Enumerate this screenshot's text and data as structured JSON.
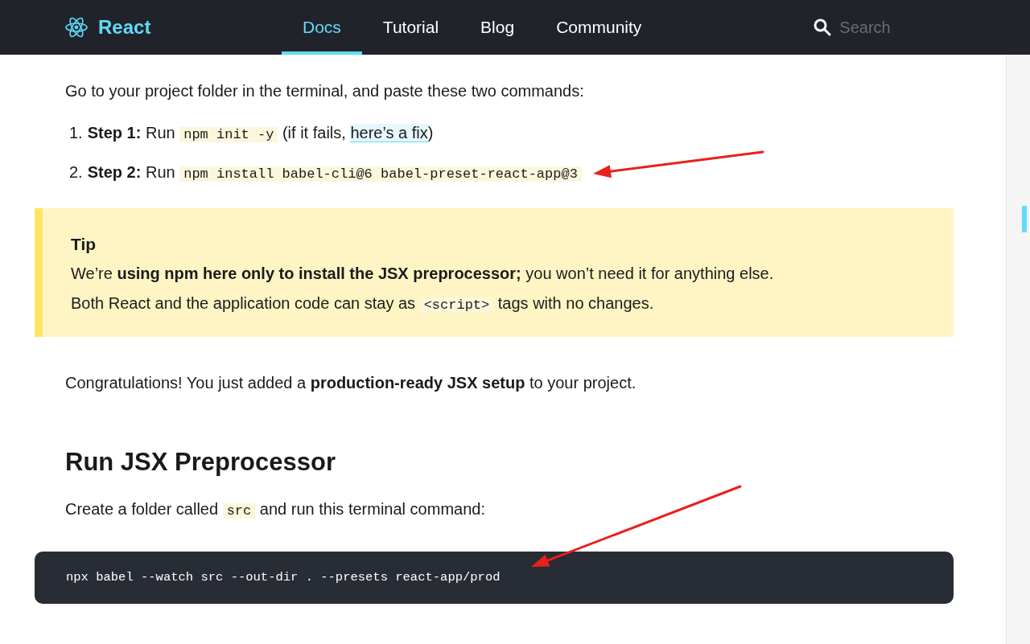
{
  "header": {
    "logo": "React",
    "nav": [
      {
        "label": "Docs",
        "selected": true
      },
      {
        "label": "Tutorial",
        "selected": false
      },
      {
        "label": "Blog",
        "selected": false
      },
      {
        "label": "Community",
        "selected": false
      }
    ],
    "search": {
      "placeholder": "Search"
    }
  },
  "content": {
    "intro": [
      {
        "kind": "text",
        "text": "Go to your project folder in the terminal, and paste these two commands:"
      }
    ],
    "steps": [
      {
        "number": "1.",
        "segments": [
          {
            "kind": "bold",
            "text": "Step 1:"
          },
          {
            "kind": "text",
            "text": " Run "
          },
          {
            "kind": "code",
            "text": "npm init -y"
          },
          {
            "kind": "text",
            "text": " (if it fails, "
          },
          {
            "kind": "link",
            "text": "here’s a fix"
          },
          {
            "kind": "text",
            "text": ")"
          }
        ]
      },
      {
        "number": "2.",
        "segments": [
          {
            "kind": "bold",
            "text": "Step 2:"
          },
          {
            "kind": "text",
            "text": " Run "
          },
          {
            "kind": "code",
            "text": "npm install babel-cli@6 babel-preset-react-app@3"
          }
        ]
      }
    ],
    "tip": {
      "title": "Tip",
      "segments": [
        {
          "kind": "text",
          "text": "We’re "
        },
        {
          "kind": "bold",
          "text": "using npm here only to install the JSX preprocessor;"
        },
        {
          "kind": "text",
          "text": " you won’t need it for anything else. Both React and the application code can stay as "
        },
        {
          "kind": "code",
          "text": "<script>"
        },
        {
          "kind": "text",
          "text": " tags with no changes."
        }
      ]
    },
    "congrats": [
      {
        "kind": "text",
        "text": "Congratulations! You just added a "
      },
      {
        "kind": "bold",
        "text": "production-ready JSX setup"
      },
      {
        "kind": "text",
        "text": " to your project."
      }
    ],
    "heading": "Run JSX Preprocessor",
    "instruction": [
      {
        "kind": "text",
        "text": "Create a folder called "
      },
      {
        "kind": "code",
        "text": "src"
      },
      {
        "kind": "text",
        "text": " and run this terminal command:"
      }
    ],
    "command": "npx babel --watch src --out-dir . --presets react-app/prod"
  },
  "annotations": [
    {
      "kind": "arrow"
    },
    {
      "kind": "arrow"
    }
  ]
}
